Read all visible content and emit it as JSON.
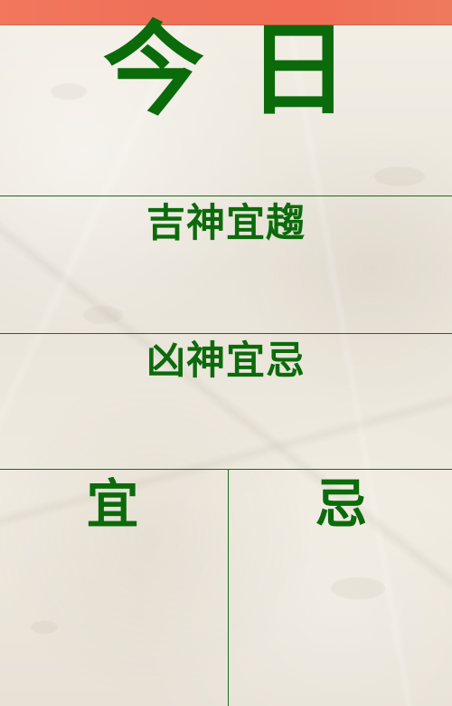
{
  "header": {
    "title": "今日"
  },
  "sections": {
    "auspicious": "吉神宜趨",
    "inauspicious": "凶神宜忌"
  },
  "columns": {
    "left": "宜",
    "right": "忌"
  },
  "colors": {
    "green": "#0b6b0b",
    "red": "#f0725a",
    "paper": "#ede8de"
  }
}
